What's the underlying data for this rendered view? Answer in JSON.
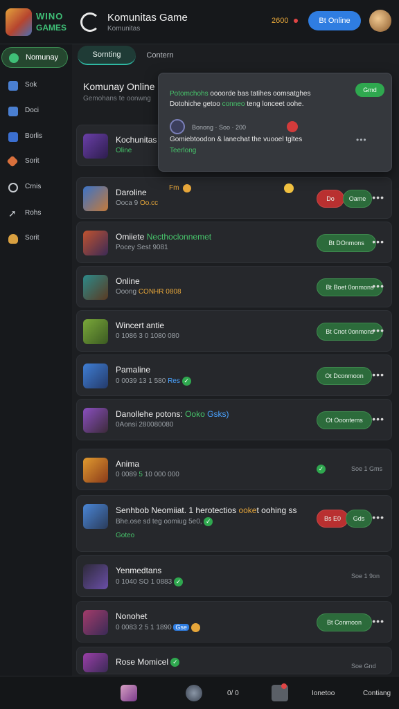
{
  "header": {
    "logo_top": "WINO",
    "logo_bottom": "GAMES",
    "title": "Komunitas Game",
    "subtitle": "Komunitas",
    "coins": "2600",
    "cta": "Bt Online"
  },
  "sidebar": {
    "items": [
      {
        "label": "Nomunay",
        "icon": "home-icon",
        "color": "#3fbf77"
      },
      {
        "label": "Sok",
        "icon": "controller-icon",
        "color": "#4a7fd1"
      },
      {
        "label": "Doci",
        "icon": "chat-icon",
        "color": "#4a7fd1"
      },
      {
        "label": "Borlis",
        "icon": "store-icon",
        "color": "#4a7fd1"
      },
      {
        "label": "Sorit",
        "icon": "sword-icon",
        "color": "#d9703c"
      },
      {
        "label": "Crnis",
        "icon": "settings-icon",
        "color": "#c8ccd1"
      },
      {
        "label": "Rohs",
        "icon": "share-icon",
        "color": "#c8ccd1"
      },
      {
        "label": "Sorit",
        "icon": "trophy-icon",
        "color": "#d9a040"
      }
    ]
  },
  "tabs": [
    "Sornting",
    "Contern"
  ],
  "section": {
    "title": "Komunay Online",
    "subtitle": "Gemohans te oonwng"
  },
  "popover": {
    "text_a": "Potomchohs",
    "text_b": "oooorde bas tatihes oomsatghes Dotohiche getoo",
    "text_c": "conneo",
    "text_d": "teng lonceet oohe.",
    "badge": "Gmd",
    "meta": "Bonong · Soo · 200",
    "line2": "Gomiebtoodon & lanechat the vuooel tgltes",
    "line3": "Teerlong",
    "dots": "•••"
  },
  "rows": [
    {
      "name": "Kochunitas",
      "sub": "",
      "extra": "Oline",
      "action": "",
      "more": "",
      "note": ""
    },
    {
      "name": "Daroline",
      "sub": "Ooca 9",
      "sub_gold": "Oo.cc",
      "sub_rest": "",
      "extra": "",
      "action": "Oame",
      "action_red": "Do",
      "more": "•••",
      "note": ""
    },
    {
      "name": "Omiiete",
      "name_green": "Necthoclonnemet",
      "sub": "Pocey Sest 9081",
      "extra": "",
      "action": "Bt DOnmons",
      "more": "•••",
      "note": ""
    },
    {
      "name": "Online",
      "sub": "Ooong",
      "sub_gold": "CONHR 0808",
      "extra": "",
      "action": "Bt Boet 0onmons",
      "more": "•••",
      "note": ""
    },
    {
      "name": "Wincert antie",
      "sub": "0 1086 3 0 1080 080",
      "extra": "",
      "action": "Bt Cnot 0onmons",
      "more": "•••",
      "note": ""
    },
    {
      "name": "Pamaline",
      "sub": "0 0039 13 1 580",
      "sub_blue": "Res",
      "extra": "",
      "action": "Ot Dconmoon",
      "more": "•••",
      "note": ""
    },
    {
      "name": "Danollehe potons:",
      "name_green": "Ooko",
      "name_blue": "Gsks)",
      "sub": "0Aonsi 280080080",
      "extra": "",
      "action": "Ot Ooontems",
      "more": "•••",
      "note": ""
    },
    {
      "name": "Anima",
      "sub": "0 0089",
      "sub_green": "5",
      "sub_rest": "10 000 000",
      "extra": "",
      "action": "",
      "more": "",
      "note": "Soe 1  Gms"
    },
    {
      "name": "Senhbob Neomiiat. 1 herotectios",
      "name_gold": "ooke",
      "name_rest": "t oohing ss",
      "sub": "Bhe.ose sd teg oomiug 5e0,",
      "extra": "Goteo",
      "action": "Gds",
      "action_red": "Bs E0",
      "more": "•••",
      "note": ""
    },
    {
      "name": "Yenmedtans",
      "sub": "0 1040 SO 1 0883",
      "extra": "",
      "action": "",
      "more": "",
      "note": "Soe 1  9on"
    },
    {
      "name": "Nonohet",
      "sub": "0 0083 2 5 1 1890",
      "sub_blue": "Gse",
      "extra": "",
      "action": "Bt Conmoon",
      "more": "•••",
      "note": ""
    },
    {
      "name": "Rose Momicel",
      "sub": "",
      "extra": "",
      "action": "",
      "more": "",
      "note": "Soe Gnd"
    }
  ],
  "bottombar": {
    "counter": "0/ 0",
    "label_a": "Ionetoo",
    "label_b": "Contiang"
  }
}
